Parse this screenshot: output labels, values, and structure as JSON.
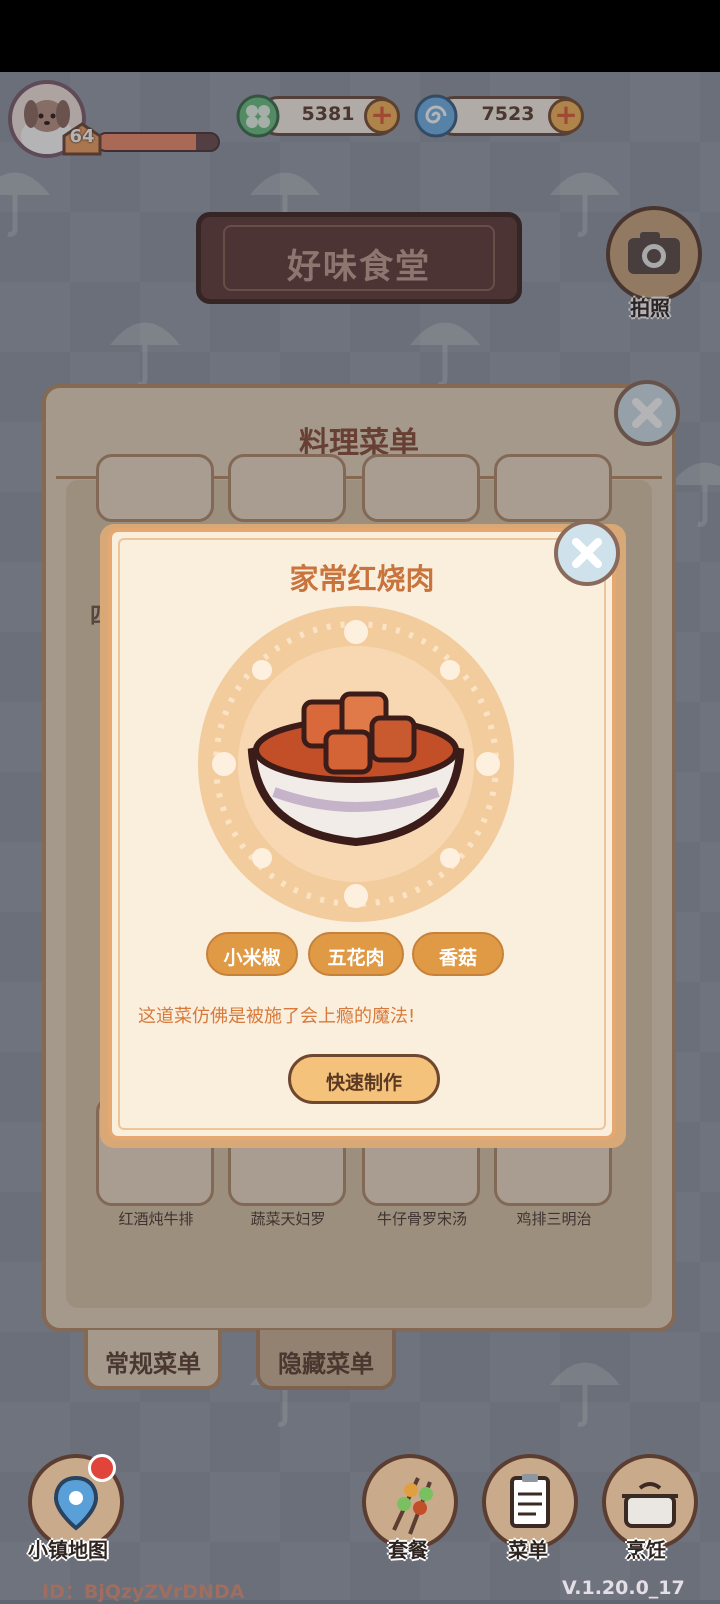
{
  "hud": {
    "level": "64",
    "xp_fraction": 0.82,
    "currency": [
      {
        "icon": "clover-icon",
        "value": "5381"
      },
      {
        "icon": "swirl-icon",
        "value": "7523"
      }
    ]
  },
  "restaurant": {
    "sign_title": "好味食堂",
    "camera_label": "拍照"
  },
  "menu_panel": {
    "title": "料理菜单",
    "section_partial": "四",
    "dishes": [
      "红酒炖牛排",
      "蔬菜天妇罗",
      "牛仔骨罗宋汤",
      "鸡排三明治"
    ],
    "tabs": [
      "常规菜单",
      "隐藏菜单"
    ]
  },
  "dish_popup": {
    "title": "家常红烧肉",
    "ingredients": [
      "小米椒",
      "五花肉",
      "香菇"
    ],
    "description": "这道菜仿佛是被施了会上瘾的魔法!",
    "quick_make_label": "快速制作"
  },
  "bottom_nav": {
    "map_label": "小镇地图",
    "set_meal_label": "套餐",
    "menu_label": "菜单",
    "cook_label": "烹饪"
  },
  "footer": {
    "id_text": "ID：BjQzyZVrDNDA",
    "version_text": "V.1.20.0_17"
  },
  "colors": {
    "accent": "#e09a45",
    "title_orange": "#c8743c",
    "panel": "#e8d6be"
  }
}
